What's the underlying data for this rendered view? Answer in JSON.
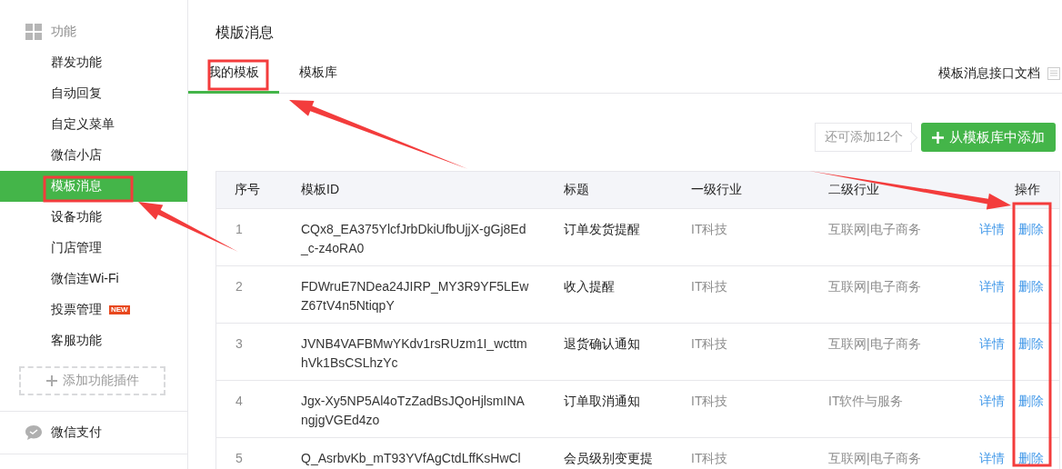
{
  "sidebar": {
    "section": {
      "label": "功能"
    },
    "items": [
      {
        "label": "群发功能",
        "selected": false
      },
      {
        "label": "自动回复",
        "selected": false
      },
      {
        "label": "自定义菜单",
        "selected": false
      },
      {
        "label": "微信小店",
        "selected": false
      },
      {
        "label": "模板消息",
        "selected": true
      },
      {
        "label": "设备功能",
        "selected": false
      },
      {
        "label": "门店管理",
        "selected": false
      },
      {
        "label": "微信连Wi-Fi",
        "selected": false
      },
      {
        "label": "投票管理",
        "selected": false,
        "badge": "NEW"
      },
      {
        "label": "客服功能",
        "selected": false
      }
    ],
    "add_plugin": "添加功能插件",
    "payment": {
      "label": "微信支付"
    }
  },
  "page_title": "模版消息",
  "tabs": [
    {
      "label": "我的模板",
      "selected": true
    },
    {
      "label": "模板库",
      "selected": false
    }
  ],
  "doc_link": "模板消息接口文档",
  "quota": "还可添加12个",
  "add_button": "从模板库中添加",
  "table": {
    "columns": [
      "序号",
      "模板ID",
      "标题",
      "一级行业",
      "二级行业",
      "操作"
    ],
    "rows": [
      {
        "index": "1",
        "template_id": "CQx8_EA375YlcfJrbDkiUfbUjjX-gGj8Ed_c-z4oRA0",
        "title": "订单发货提醒",
        "industry_1": "IT科技",
        "industry_2": "互联网|电子商务",
        "actions": [
          "详情",
          "删除"
        ]
      },
      {
        "index": "2",
        "template_id": "FDWruE7NDea24JIRP_MY3R9YF5LEwZ67tV4n5NtiqpY",
        "title": "收入提醒",
        "industry_1": "IT科技",
        "industry_2": "互联网|电子商务",
        "actions": [
          "详情",
          "删除"
        ]
      },
      {
        "index": "3",
        "template_id": "JVNB4VAFBMwYKdv1rsRUzm1I_wcttmhVk1BsCSLhzYc",
        "title": "退货确认通知",
        "industry_1": "IT科技",
        "industry_2": "互联网|电子商务",
        "actions": [
          "详情",
          "删除"
        ]
      },
      {
        "index": "4",
        "template_id": "Jgx-Xy5NP5Al4oTzZadBsJQoHjlsmINAngjgVGEd4zo",
        "title": "订单取消通知",
        "industry_1": "IT科技",
        "industry_2": "IT软件与服务",
        "actions": [
          "详情",
          "删除"
        ]
      },
      {
        "index": "5",
        "template_id": "Q_AsrbvKb_mT93YVfAgCtdLffKsHwCl",
        "title": "会员级别变更提",
        "industry_1": "IT科技",
        "industry_2": "互联网|电子商务",
        "actions": [
          "详情",
          "删除"
        ]
      }
    ]
  }
}
